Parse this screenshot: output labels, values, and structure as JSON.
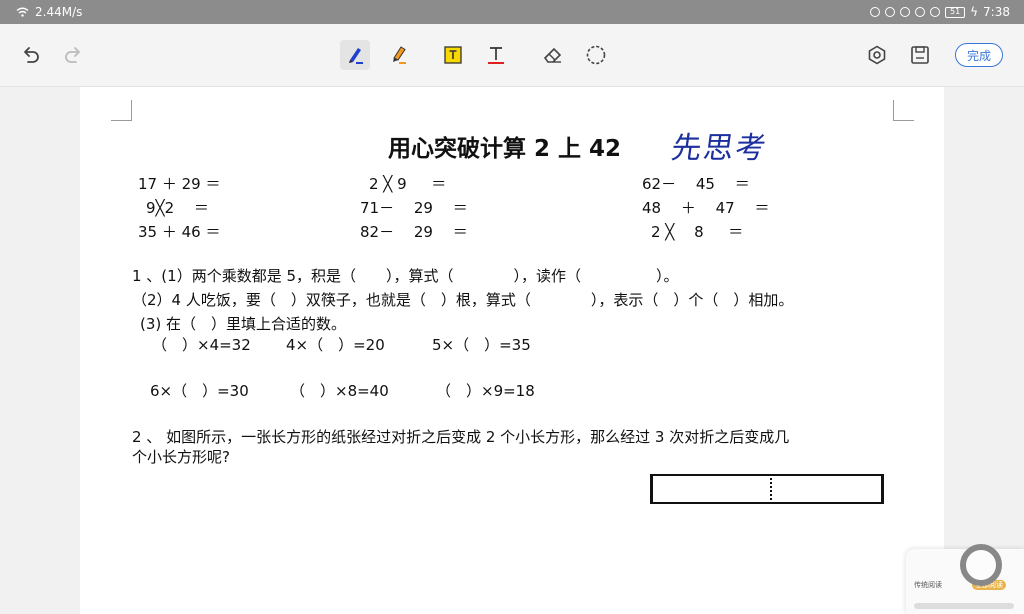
{
  "status_bar": {
    "speed": "2.44M/s",
    "battery": "51",
    "time": "7:38"
  },
  "toolbar": {
    "undo_icon": "undo-icon",
    "redo_icon": "redo-icon",
    "tools": [
      "pen-icon",
      "highlighter-icon",
      "text-box-icon",
      "text-cursor-icon",
      "eraser-icon",
      "lasso-icon"
    ],
    "right_tools": [
      "settings-icon",
      "save-icon"
    ],
    "done_label": "完成",
    "colors": {
      "pen": "#1f3fd1",
      "highlighter": "#f39a1e",
      "text_box": "#f7d800",
      "text_line": "#e02020",
      "accent": "#3a78d8"
    }
  },
  "document": {
    "title": "用心突破计算 2 上 42",
    "handwriting": "先思考",
    "calc": [
      [
        "17 ＋ 29 ＝",
        "2 ╳ 9 　 ＝",
        "62－ 　45 　＝"
      ],
      [
        "9╳2 　＝",
        "71－ 　29 　＝",
        "48 　＋ 　47 　＝"
      ],
      [
        "35 ＋ 46 ＝",
        "82－ 　29 　＝",
        "2 ╳ 　8 　 ＝"
      ]
    ],
    "q1_line1": "1 、(1）两个乘数都是 5，积是（　　），算式（　　　　），读作（　　　　　）。",
    "q1_line2": "（2）4 人吃饭，要（　）双筷子，也就是（　）根，算式（　　　　），表示（　）个（　）相加。",
    "q1_line3": "(3) 在（　）里填上合适的数。",
    "q1_fill_row1": [
      "（　）×4=32",
      "4×（　）=20",
      "5×（　）=35"
    ],
    "q1_fill_row2": [
      "6×（　）=30",
      "（　）×8=40",
      "（　）×9=18"
    ],
    "q2_line1": "2 、 如图所示，一张长方形的纸张经过对折之后变成 2 个小长方形，那么经过 3 次对折之后变成几",
    "q2_line2": "个小长方形呢?"
  },
  "floating_widget": {
    "label_left": "传统阅读",
    "label_right": "全部阅读"
  }
}
